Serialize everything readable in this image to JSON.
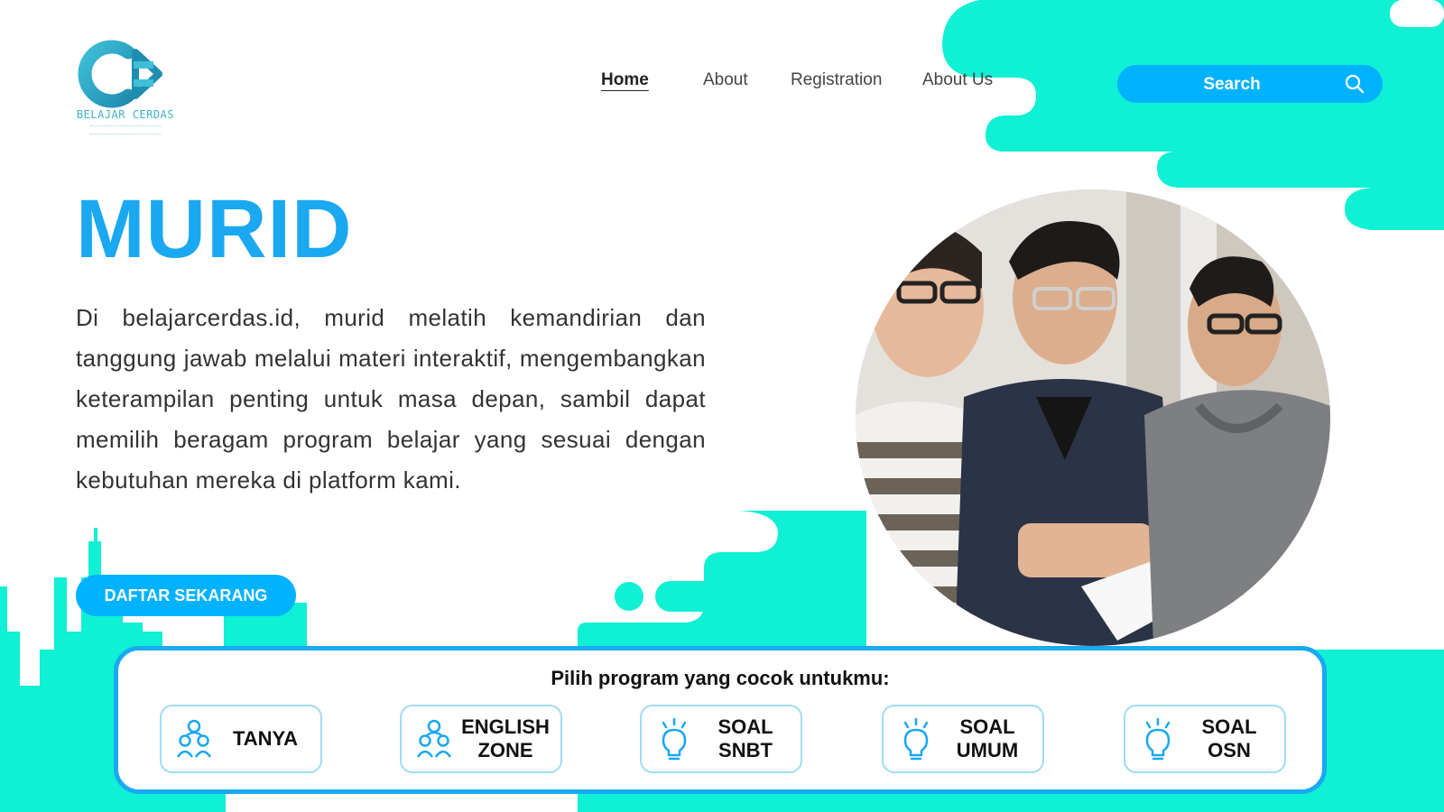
{
  "brand": {
    "logo_text": "BELAJAR CERDAS"
  },
  "nav": {
    "items": [
      {
        "label": "Home",
        "active": true
      },
      {
        "label": "About",
        "active": false
      },
      {
        "label": "Registration",
        "active": false
      },
      {
        "label": "About Us",
        "active": false
      }
    ]
  },
  "search": {
    "label": "Search",
    "icon": "search-icon"
  },
  "hero": {
    "title": "MURID",
    "description": "Di belajarcerdas.id, murid melatih kemandirian dan tanggung jawab melalui materi interaktif, mengembangkan keterampilan penting untuk masa depan, sambil dapat memilih beragam program belajar yang sesuai dengan kebutuhan mereka di platform kami.",
    "cta_label": "DAFTAR SEKARANG",
    "photo": "students-in-class-photo"
  },
  "programs": {
    "title": "Pilih program yang cocok untukmu:",
    "items": [
      {
        "label": "TANYA",
        "icon": "people-group-icon"
      },
      {
        "label": "ENGLISH ZONE",
        "icon": "people-group-icon"
      },
      {
        "label": "SOAL SNBT",
        "icon": "lightbulb-icon"
      },
      {
        "label": "SOAL UMUM",
        "icon": "lightbulb-icon"
      },
      {
        "label": "SOAL OSN",
        "icon": "lightbulb-icon"
      }
    ]
  },
  "colors": {
    "accent_blue": "#00b2ff",
    "title_blue": "#1aa8f0",
    "mint": "#0ff0d4"
  }
}
